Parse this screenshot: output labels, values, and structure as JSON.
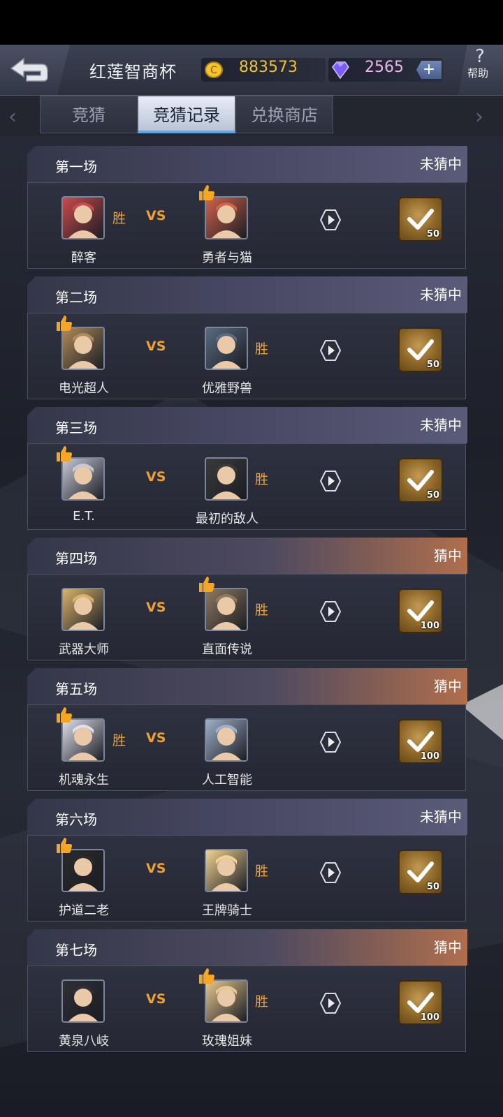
{
  "header": {
    "title": "红莲智商杯",
    "gold": "883573",
    "gems": "2565",
    "plus": "+",
    "help": "帮助",
    "help_glyph": "?",
    "gold_color": "#f1c232",
    "gem_color": "#f0b5f0"
  },
  "tabs": [
    {
      "label": "竞猜",
      "active": false
    },
    {
      "label": "竞猜记录",
      "active": true
    },
    {
      "label": "兑换商店",
      "active": false
    }
  ],
  "nav": {
    "left": "‹",
    "right": "›"
  },
  "vs_label": "VS",
  "win_label": "胜",
  "matches": [
    {
      "title": "第一场",
      "status": "未猜中",
      "left": "醉客",
      "right": "勇者与猫",
      "winner": "left",
      "pick": "right",
      "reward": "50"
    },
    {
      "title": "第二场",
      "status": "未猜中",
      "left": "电光超人",
      "right": "优雅野兽",
      "winner": "right",
      "pick": "left",
      "reward": "50"
    },
    {
      "title": "第三场",
      "status": "未猜中",
      "left": "E.T.",
      "right": "最初的敌人",
      "winner": "right",
      "pick": "left",
      "reward": "50"
    },
    {
      "title": "第四场",
      "status": "猜中",
      "left": "武器大师",
      "right": "直面传说",
      "winner": "right",
      "pick": "right",
      "reward": "100"
    },
    {
      "title": "第五场",
      "status": "猜中",
      "left": "机魂永生",
      "right": "人工智能",
      "winner": "left",
      "pick": "left",
      "reward": "100"
    },
    {
      "title": "第六场",
      "status": "未猜中",
      "left": "护道二老",
      "right": "王牌骑士",
      "winner": "right",
      "pick": "left",
      "reward": "50"
    },
    {
      "title": "第七场",
      "status": "猜中",
      "left": "黄泉八岐",
      "right": "玫瑰姐妹",
      "winner": "right",
      "pick": "right",
      "reward": "100"
    }
  ]
}
